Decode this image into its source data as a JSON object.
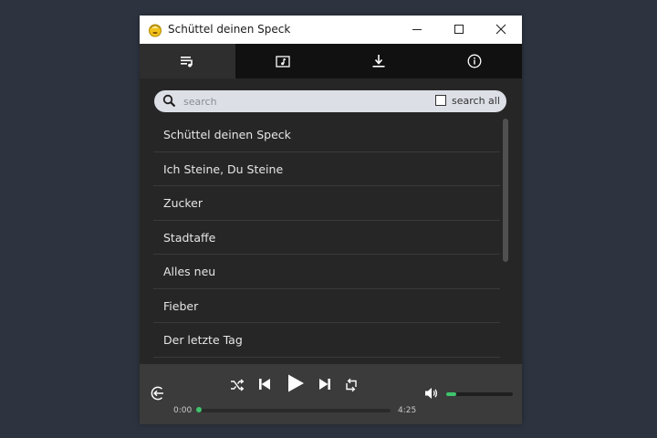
{
  "window": {
    "title": "Schüttel deinen Speck",
    "controls": {
      "minimize": "minimize-icon",
      "maximize": "maximize-icon",
      "close": "close-icon"
    }
  },
  "tabs": [
    {
      "icon": "playlist-icon",
      "active": true
    },
    {
      "icon": "music-folder-icon",
      "active": false
    },
    {
      "icon": "download-icon",
      "active": false
    },
    {
      "icon": "info-icon",
      "active": false
    }
  ],
  "search": {
    "placeholder": "search",
    "value": "",
    "search_all_label": "search all",
    "search_all_checked": false
  },
  "tracks": [
    "Schüttel deinen Speck",
    "Ich Steine, Du Steine",
    "Zucker",
    "Stadtaffe",
    "Alles neu",
    "Fieber",
    "Der letzte Tag"
  ],
  "player": {
    "current_time": "0:00",
    "total_time": "4:25",
    "progress": 0,
    "volume": 0.15
  },
  "colors": {
    "accent": "#3ec46d",
    "background": "#2d3440",
    "window": "#262626",
    "tabbar": "#111111",
    "player": "#3b3b3b"
  }
}
